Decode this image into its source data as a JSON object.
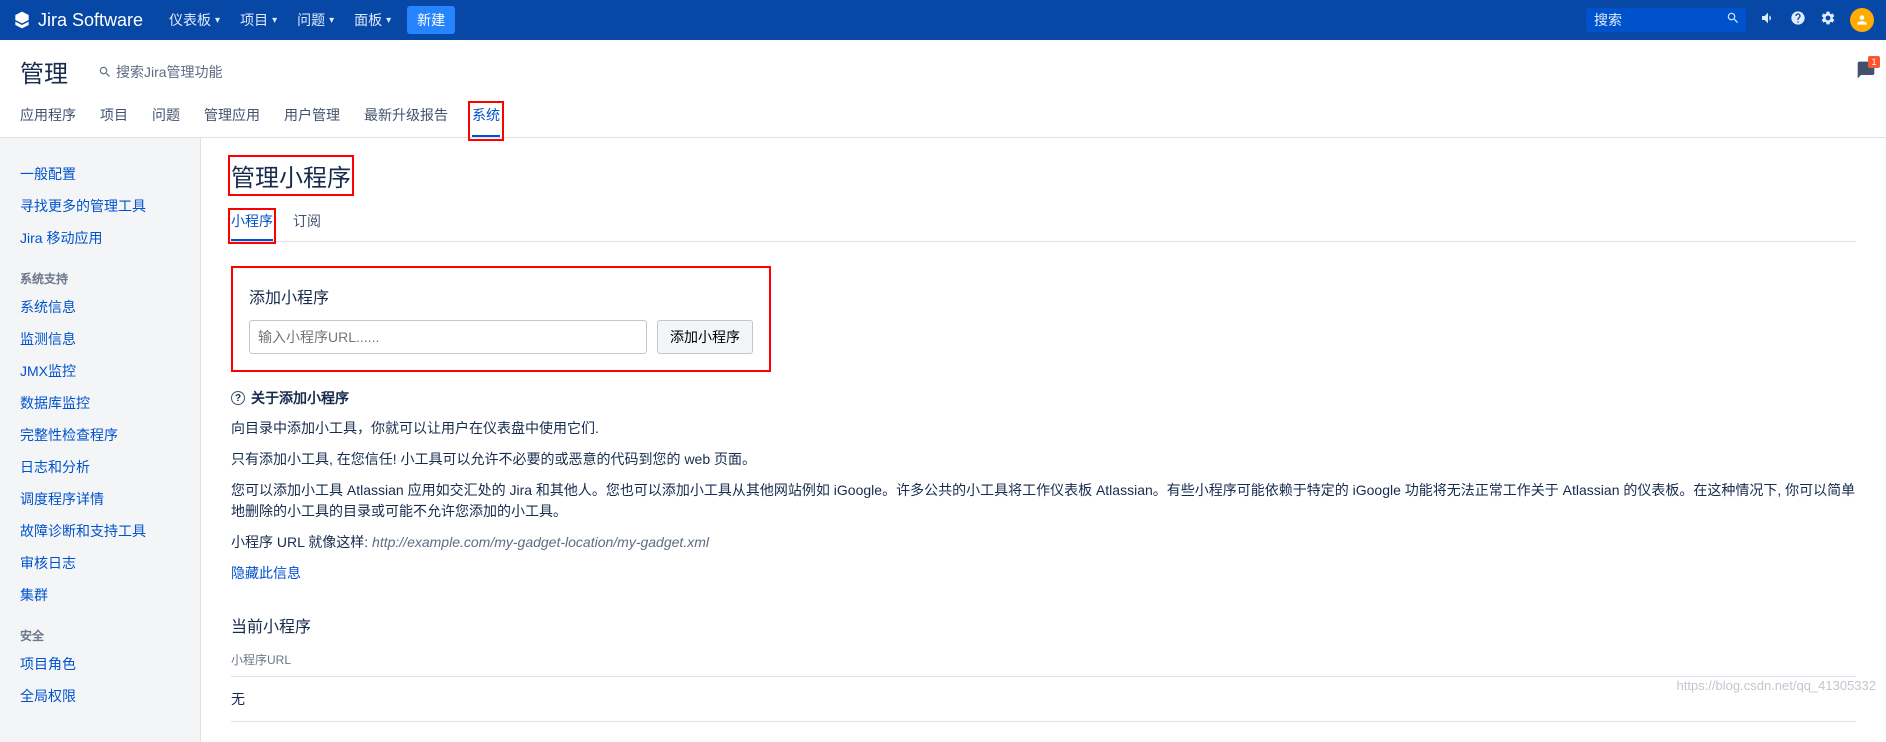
{
  "top": {
    "logo": "Jira Software",
    "nav": [
      "仪表板",
      "项目",
      "问题",
      "面板"
    ],
    "create": "新建",
    "search_placeholder": "搜索"
  },
  "sub": {
    "title": "管理",
    "search_placeholder": "搜索Jira管理功能",
    "tabs": [
      "应用程序",
      "项目",
      "问题",
      "管理应用",
      "用户管理",
      "最新升级报告",
      "系统"
    ],
    "active_tab": 6
  },
  "sidebar": {
    "group1": [
      "一般配置",
      "寻找更多的管理工具",
      "Jira 移动应用"
    ],
    "group2_head": "系统支持",
    "group2": [
      "系统信息",
      "监测信息",
      "JMX监控",
      "数据库监控",
      "完整性检查程序",
      "日志和分析",
      "调度程序详情",
      "故障诊断和支持工具",
      "审核日志",
      "集群"
    ],
    "group3_head": "安全",
    "group3": [
      "项目角色",
      "全局权限"
    ]
  },
  "main": {
    "title": "管理小程序",
    "inner_tabs": [
      "小程序",
      "订阅"
    ],
    "add_heading": "添加小程序",
    "url_placeholder": "输入小程序URL......",
    "add_button": "添加小程序",
    "about_heading": "关于添加小程序",
    "p1": "向目录中添加小工具，你就可以让用户在仪表盘中使用它们.",
    "p2": "只有添加小工具, 在您信任! 小工具可以允许不必要的或恶意的代码到您的 web 页面。",
    "p3": "您可以添加小工具 Atlassian 应用如交汇处的 Jira 和其他人。您也可以添加小工具从其他网站例如 iGoogle。许多公共的小工具将工作仪表板 Atlassian。有些小程序可能依赖于特定的 iGoogle 功能将无法正常工作关于 Atlassian 的仪表板。在这种情况下, 你可以简单地删除的小工具的目录或可能不允许您添加的小工具。",
    "p4_prefix": "小程序 URL 就像这样: ",
    "p4_example": "http://example.com/my-gadget-location/my-gadget.xml",
    "hide": "隐藏此信息",
    "current_heading": "当前小程序",
    "table_header": "小程序URL",
    "table_empty": "无"
  },
  "watermark": "https://blog.csdn.net/qq_41305332"
}
